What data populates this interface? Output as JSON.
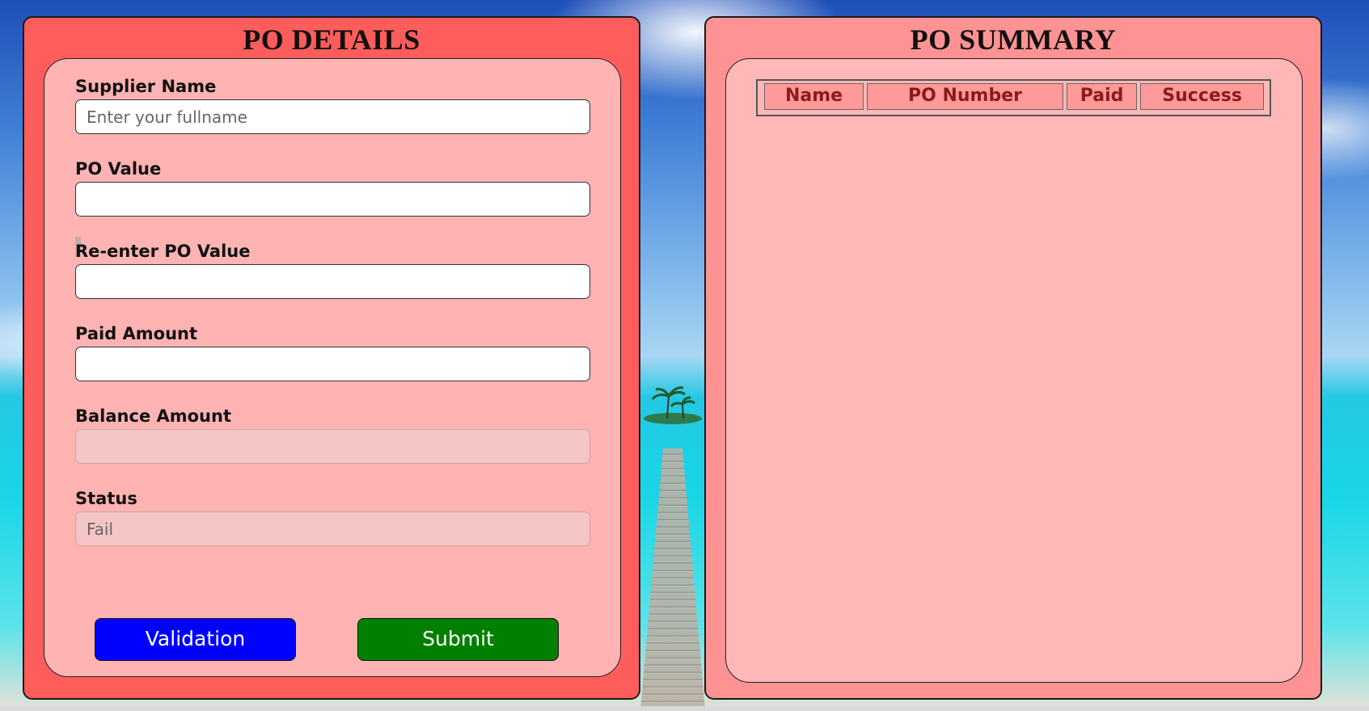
{
  "po_details": {
    "title": "PO DETAILS",
    "supplier_name": {
      "label": "Supplier Name",
      "placeholder": "Enter your fullname",
      "value": ""
    },
    "po_value": {
      "label": "PO Value",
      "value": ""
    },
    "reenter_po_value": {
      "label": "Re-enter PO Value",
      "value": ""
    },
    "paid_amount": {
      "label": "Paid Amount",
      "value": ""
    },
    "balance_amount": {
      "label": "Balance Amount",
      "value": ""
    },
    "status": {
      "label": "Status",
      "value": "Fail"
    },
    "buttons": {
      "validation": "Validation",
      "submit": "Submit"
    }
  },
  "po_summary": {
    "title": "PO SUMMARY",
    "columns": [
      "Name",
      "PO Number",
      "Paid",
      "Success"
    ],
    "rows": []
  },
  "colors": {
    "details_panel": "#ff5c5c",
    "summary_panel": "#ff9393",
    "inner_panel": "#ffb3b3",
    "validation_button": "#0000ff",
    "submit_button": "#008000",
    "table_header_text": "#8b1a1a"
  }
}
